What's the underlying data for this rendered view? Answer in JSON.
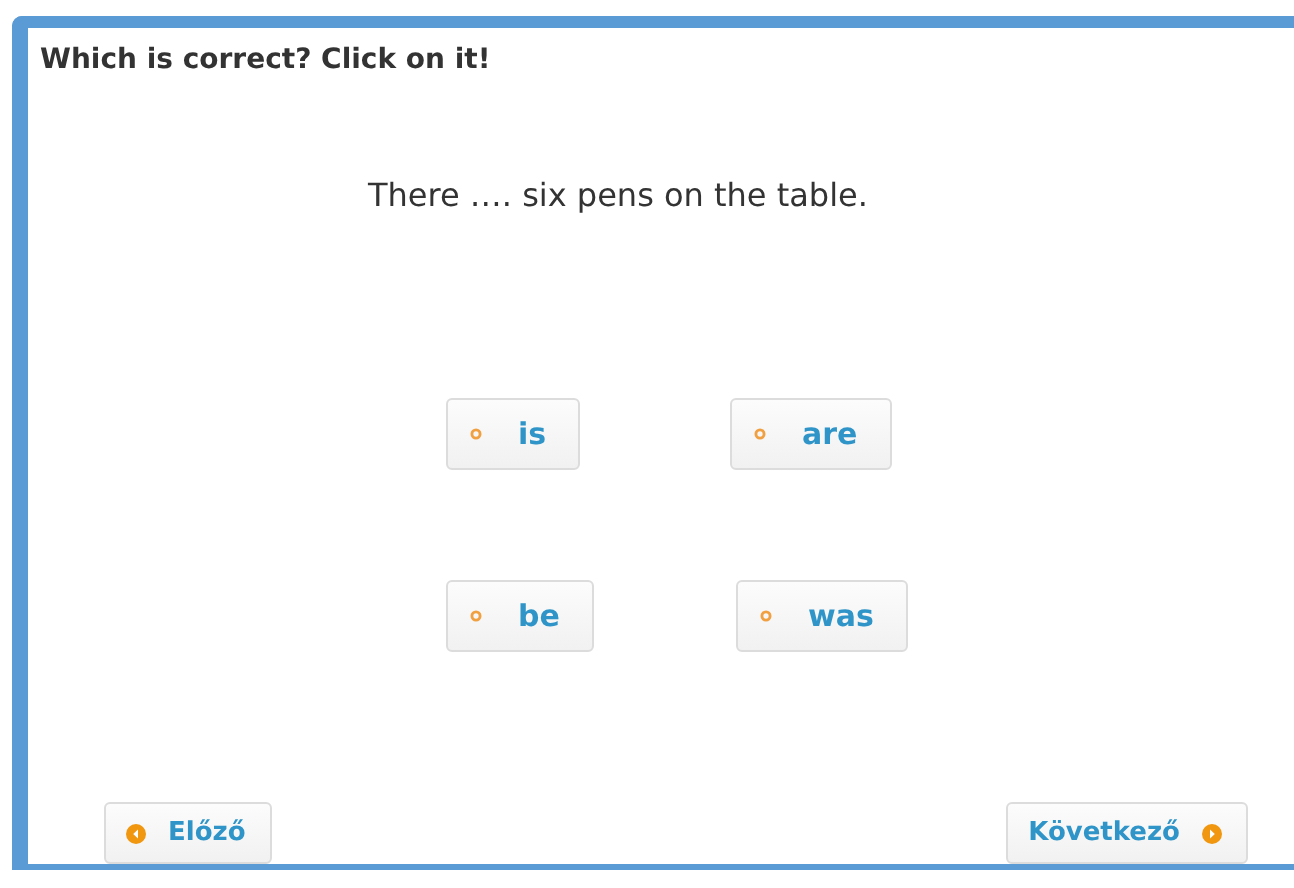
{
  "instruction": "Which is correct? Click on it!",
  "question": "There …. six pens on the table.",
  "options": [
    {
      "label": "is"
    },
    {
      "label": "are"
    },
    {
      "label": "be"
    },
    {
      "label": "was"
    }
  ],
  "navigation": {
    "previous": "Előző",
    "next": "Következő"
  }
}
